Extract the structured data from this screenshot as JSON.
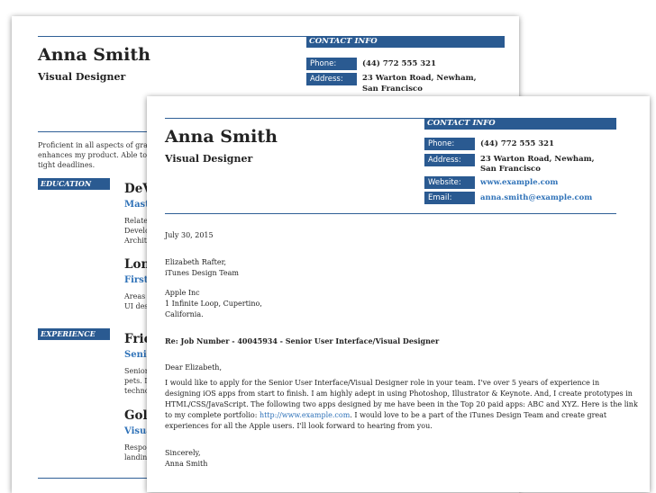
{
  "resume": {
    "name": "Anna Smith",
    "title": "Visual Designer",
    "contact_header": "CONTACT INFO",
    "phone_label": "Phone:",
    "phone": "(44) 772 555 321",
    "address_label": "Address:",
    "address_line1": "23 Warton Road, Newham,",
    "address_line2": "San Francisco",
    "summary_lines": [
      "Proficient in all aspects of gra",
      "enhances my product. Able to",
      "tight deadlines."
    ],
    "education_label": "EDUCATION",
    "edu1_title": "DeV",
    "edu1_subtitle": "Mast",
    "edu1_lines": [
      "Relate",
      "Develo",
      "Archit"
    ],
    "edu2_title": "Lon",
    "edu2_subtitle": "First",
    "edu2_lines": [
      "Areas",
      "UI des"
    ],
    "experience_label": "EXPERIENCE",
    "exp1_title": "Frie",
    "exp1_subtitle": "Senio",
    "exp1_lines": [
      "Senior",
      "pets. I",
      "techno"
    ],
    "exp2_title": "Gol",
    "exp2_subtitle": "Visua",
    "exp2_lines": [
      "Respo",
      "landin"
    ]
  },
  "letter": {
    "name": "Anna Smith",
    "title": "Visual Designer",
    "contact_header": "CONTACT INFO",
    "phone_label": "Phone:",
    "phone": "(44) 772 555 321",
    "address_label": "Address:",
    "address_line1": "23 Warton Road, Newham,",
    "address_line2": "San Francisco",
    "website_label": "Website:",
    "website": "www.example.com",
    "email_label": "Email:",
    "email": "anna.smith@example.com",
    "date": "July 30, 2015",
    "recipient_name": "Elizabeth Rafter,",
    "recipient_team": "iTunes Design Team",
    "company": "Apple Inc",
    "street": "1 Infinite Loop, Cupertino,",
    "state": "California.",
    "subject": "Re: Job Number - 40045934 - Senior User Interface/Visual Designer",
    "salutation": "Dear Elizabeth,",
    "body_line1": "I would like to apply for the Senior User Interface/Visual Designer role in your team. I've over 5 years of experience in",
    "body_line2": "designing iOS apps from start to finish. I am highly adept in using Photoshop, Illustrator & Keynote. And, I create prototypes in",
    "body_line3": "HTML/CSS/JavaScript. The following two apps designed by me have been in the Top 20 paid apps: ABC and XYZ. Here is the link",
    "body_line4_pre": "to my complete portfolio: ",
    "body_line4_link": "http://www.example.com",
    "body_line4_post": ". I would love to be a part of the iTunes Design Team and create great",
    "body_line5": "experiences for all the Apple users. I'll look forward to hearing from you.",
    "closing": "Sincerely,",
    "signature": "Anna Smith"
  }
}
